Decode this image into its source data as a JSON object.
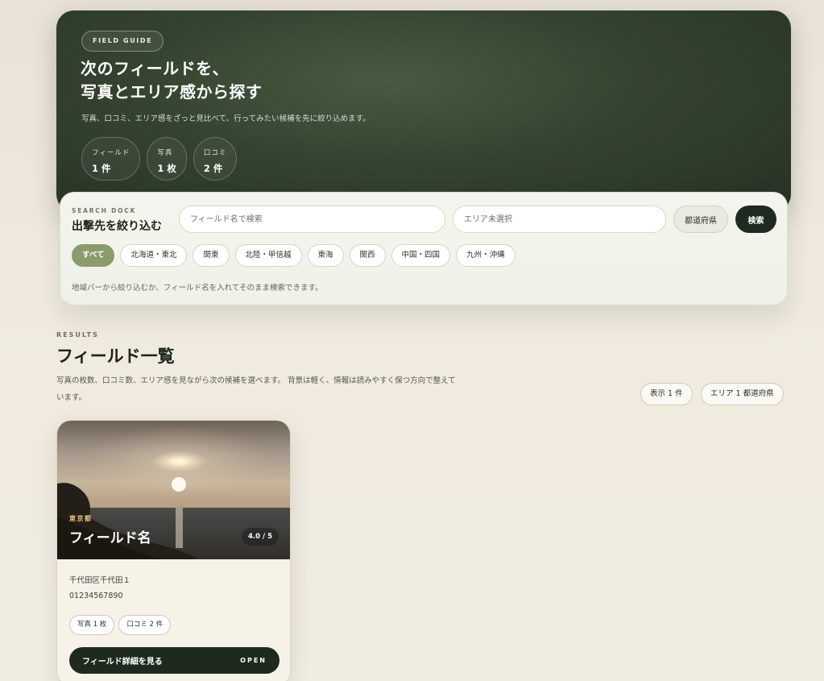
{
  "hero": {
    "tag": "FIELD GUIDE",
    "title_line1": "次のフィールドを、",
    "title_line2": "写真とエリア感から探す",
    "subtitle": "写真、口コミ、エリア感をざっと見比べて、行ってみたい候補を先に絞り込めます。",
    "stats": [
      {
        "label": "フィールド",
        "value": "1 件"
      },
      {
        "label": "写真",
        "value": "1 枚"
      },
      {
        "label": "口コミ",
        "value": "2 件"
      }
    ]
  },
  "search": {
    "eyebrow": "SEARCH DOCK",
    "title": "出撃先を絞り込む",
    "name_placeholder": "フィールド名で検索",
    "area_placeholder": "エリア未選択",
    "prefecture_button": "都道府県",
    "search_button": "検索",
    "regions": [
      "すべて",
      "北海道・東北",
      "関東",
      "北陸・甲信越",
      "東海",
      "関西",
      "中国・四国",
      "九州・沖縄"
    ],
    "active_region": "すべて",
    "hint": "地域バーから絞り込むか、フィールド名を入れてそのまま検索できます。"
  },
  "results": {
    "eyebrow": "RESULTS",
    "title": "フィールド一覧",
    "description": "写真の枚数、口コミ数、エリア感を見ながら次の候補を選べます。 背景は軽く、情報は読みやすく保つ方向で整えています。",
    "count_pill": "表示 1 件",
    "area_pill": "エリア 1 都道府県"
  },
  "cards": [
    {
      "prefecture": "東京都",
      "name": "フィールド名",
      "rating": "4.0 / 5",
      "address": "千代田区千代田１",
      "phone": "01234567890",
      "tags": [
        "写真 1 枚",
        "口コミ 2 件"
      ],
      "button_label": "フィールド詳細を見る",
      "button_open": "OPEN"
    }
  ],
  "colors": {
    "hero_bg": "#34432f",
    "accent_chip": "#8a9b6c",
    "dark_button": "#1e2a1f",
    "prefecture_label": "#e8c77e"
  }
}
